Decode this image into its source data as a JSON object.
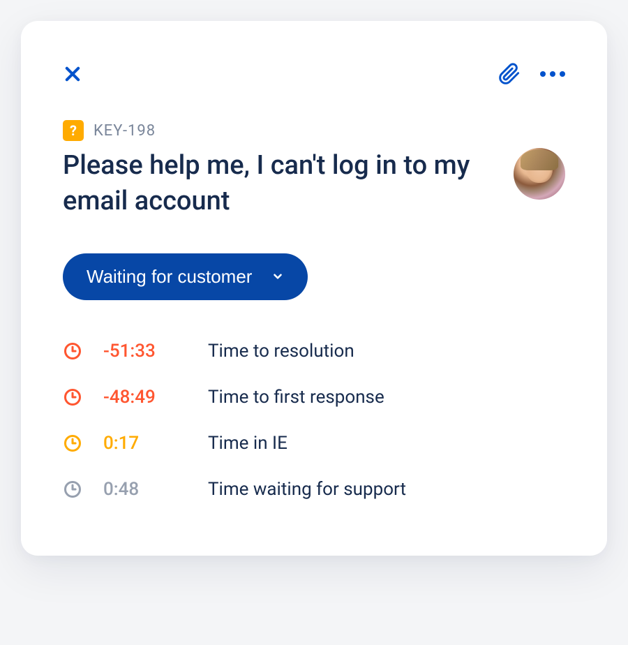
{
  "issue": {
    "key": "KEY-198",
    "title": "Please help me, I can't log in to my email account",
    "status": "Waiting for customer"
  },
  "sla": [
    {
      "icon_color": "#FF5630",
      "time": "-51:33",
      "time_color": "red",
      "label": "Time to resolution"
    },
    {
      "icon_color": "#FF5630",
      "time": "-48:49",
      "time_color": "red",
      "label": "Time to first response"
    },
    {
      "icon_color": "#FFAB00",
      "time": "0:17",
      "time_color": "amber",
      "label": "Time in IE"
    },
    {
      "icon_color": "#97A0AF",
      "time": "0:48",
      "time_color": "gray",
      "label": "Time waiting for support"
    }
  ]
}
